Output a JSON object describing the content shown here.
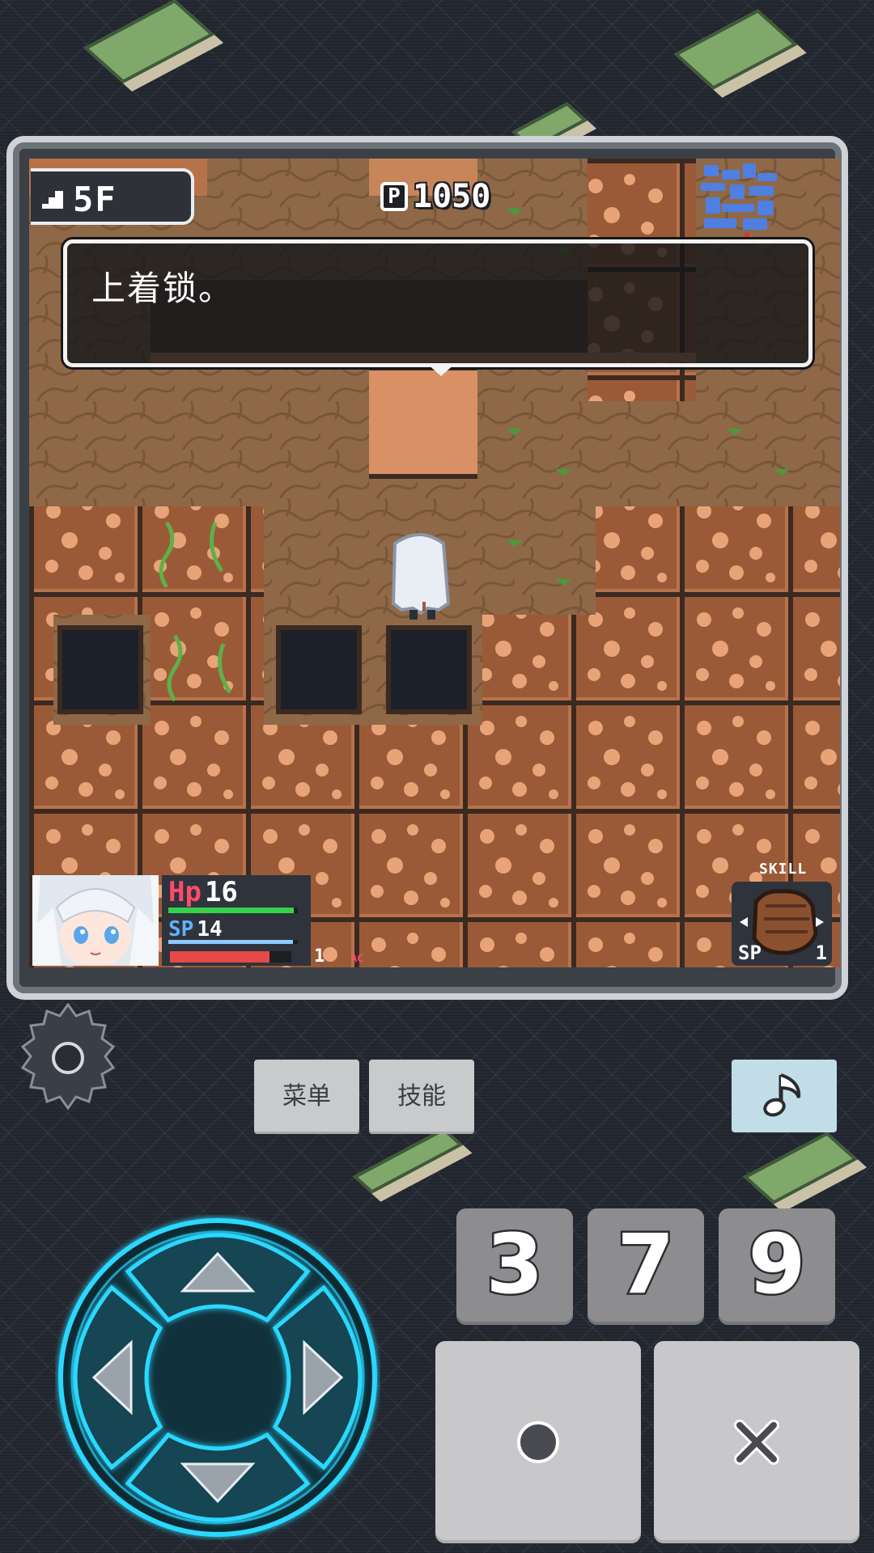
{
  "hud": {
    "floor": "5F",
    "points": "1050"
  },
  "dialog": {
    "text": "上着锁。"
  },
  "status": {
    "hp_label": "Hp",
    "hp_value": "16",
    "sp_label": "SP",
    "sp_value": "14",
    "hp_fraction": 0.97,
    "sp_fraction": 0.96,
    "exp_fraction": 0.82,
    "level": "1",
    "level_suffix": "AC"
  },
  "skill": {
    "label": "SKILL",
    "sp_label": "SP",
    "cost": "1",
    "icon": "fist-icon"
  },
  "buttons": {
    "menu": "菜单",
    "skills": "技能",
    "music_icon": "music-note-icon",
    "settings_icon": "gear-icon"
  },
  "keys": {
    "k3": "3",
    "k7": "7",
    "k9": "9",
    "confirm_icon": "circle-icon",
    "cancel_icon": "cross-icon"
  },
  "colors": {
    "hp": "#ff4a6a",
    "sp": "#5fb2ff",
    "hp_bar": "#34d24a",
    "sp_bar": "#8ec9ff",
    "exp_bar": "#e84848",
    "dpad_glow": "#29d8ff"
  }
}
